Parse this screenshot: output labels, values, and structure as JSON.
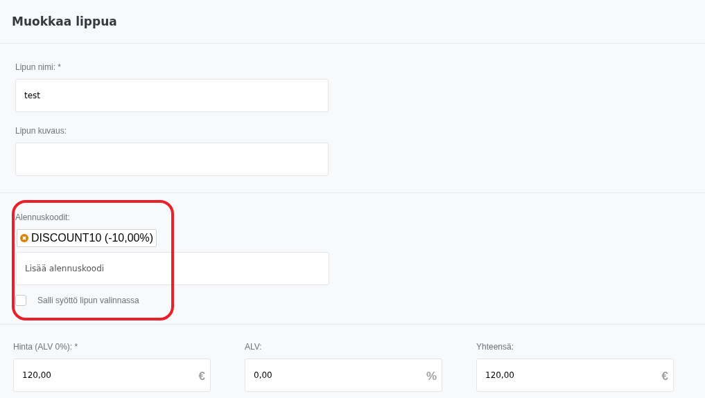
{
  "title": "Muokkaa lippua",
  "name_field": {
    "label": "Lipun nimi: *",
    "value": "test"
  },
  "description_field": {
    "label": "Lipun kuvaus:"
  },
  "discounts": {
    "label": "Alennuskoodit:",
    "highlighted": true,
    "codes": [
      {
        "text": "DISCOUNT10 (-10,00%)"
      }
    ],
    "input": {
      "placeholder": "Lisää alennuskoodi"
    },
    "allow_entry": {
      "label": "Salli syöttö lipun valinnassa",
      "checked": false
    }
  },
  "price_fields": [
    {
      "label": "Hinta (ALV 0%): *",
      "value": "120,00",
      "unit": "€"
    },
    {
      "label": "ALV:",
      "value": "0,00",
      "unit": "%"
    },
    {
      "label": "Yhteensä:",
      "value": "120,00",
      "unit": "€"
    }
  ]
}
